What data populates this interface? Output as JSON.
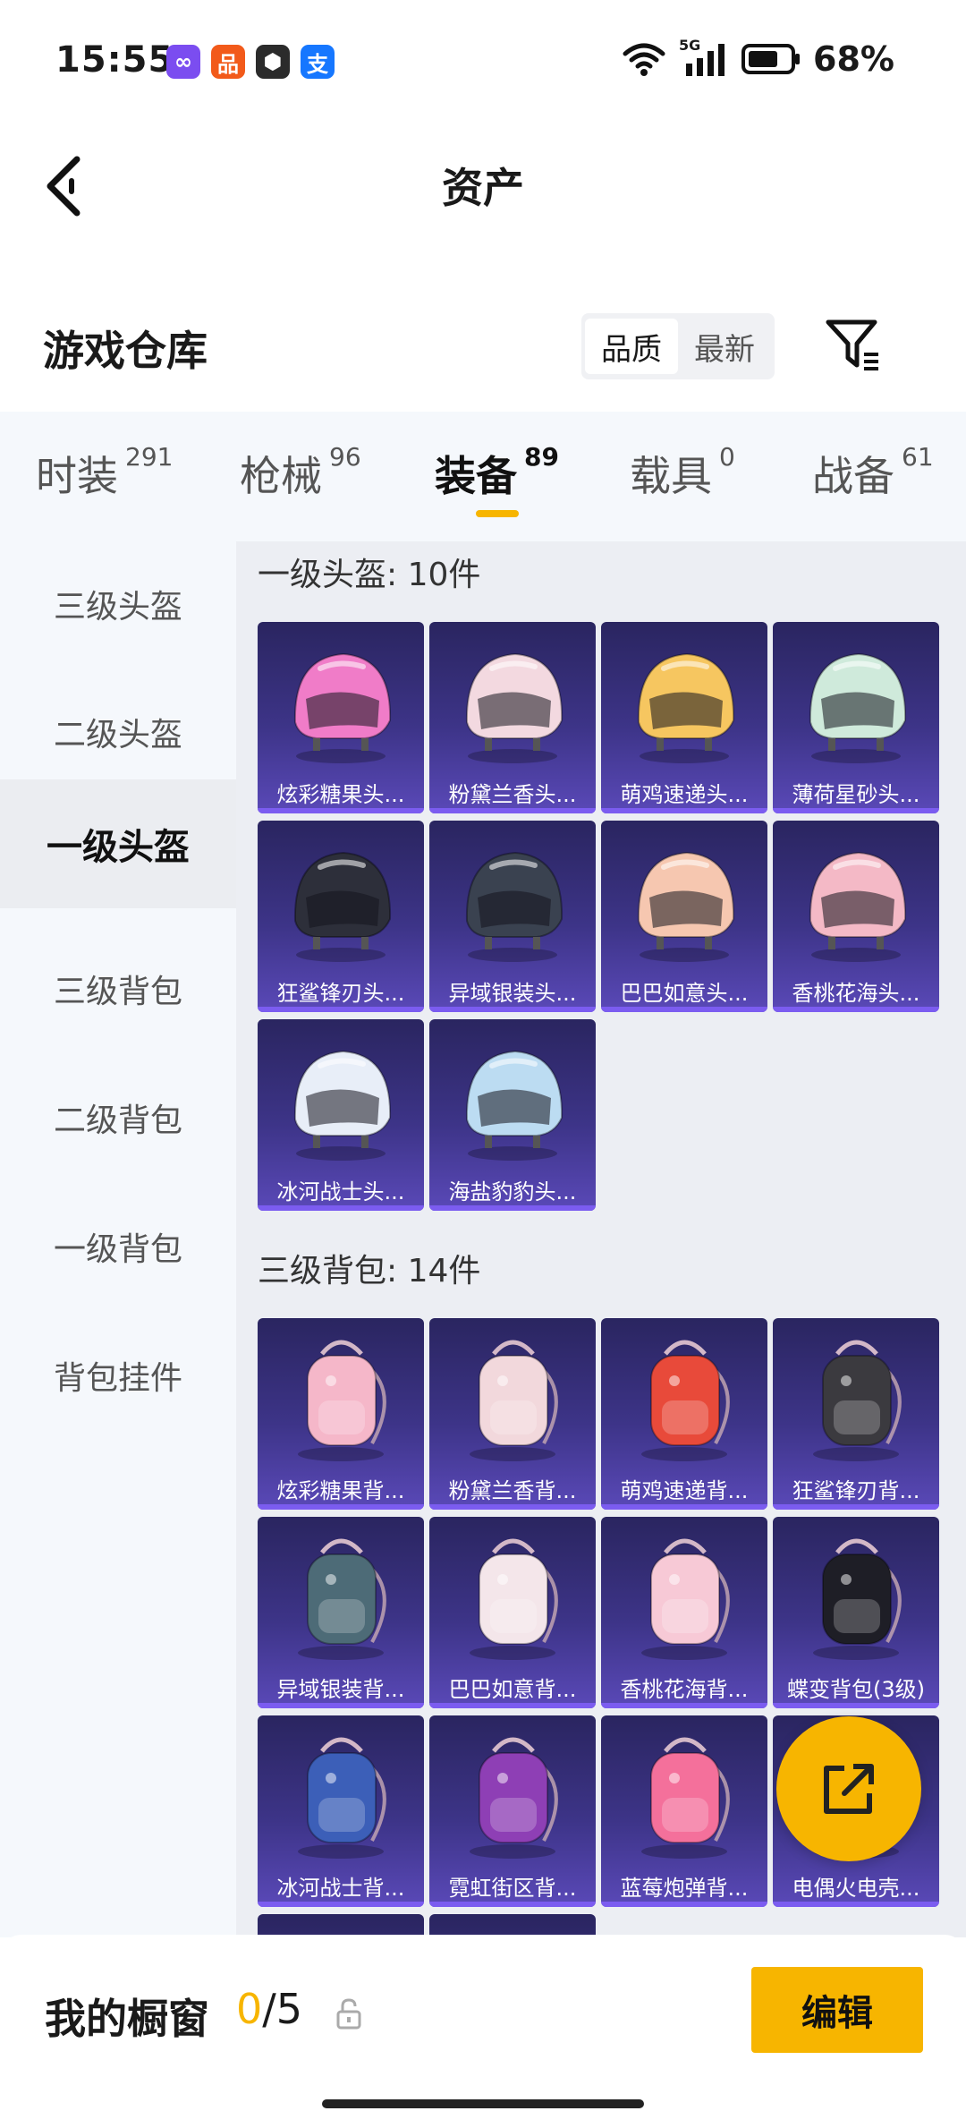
{
  "status_bar": {
    "time": "15:55",
    "network": "5G",
    "battery": "68%",
    "app_icons": [
      {
        "name": "infinity-app-icon",
        "glyph": "∞",
        "color": "#7b4df0"
      },
      {
        "name": "xiaohongshu-app-icon",
        "glyph": "品",
        "color": "#f25a1a"
      },
      {
        "name": "game-app-icon",
        "glyph": "⬢",
        "color": "#2b2b2b"
      },
      {
        "name": "alipay-app-icon",
        "glyph": "支",
        "color": "#1677ff"
      }
    ]
  },
  "header": {
    "title": "资产"
  },
  "section": {
    "title": "游戏仓库",
    "sort_options": [
      "品质",
      "最新"
    ],
    "active_sort": 0
  },
  "tabs": [
    {
      "label": "时装",
      "count": "291"
    },
    {
      "label": "枪械",
      "count": "96"
    },
    {
      "label": "装备",
      "count": "89"
    },
    {
      "label": "载具",
      "count": "0"
    },
    {
      "label": "战备",
      "count": "61"
    }
  ],
  "active_tab": 2,
  "side_nav": [
    "三级头盔",
    "二级头盔",
    "一级头盔",
    "三级背包",
    "二级背包",
    "一级背包",
    "背包挂件"
  ],
  "active_side": 2,
  "groups": [
    {
      "title": "一级头盔: 10件",
      "items": [
        {
          "label": "炫彩糖果头...",
          "color": "#f07cc8",
          "kind": "helmet"
        },
        {
          "label": "粉黛兰香头...",
          "color": "#f3d9e0",
          "kind": "helmet"
        },
        {
          "label": "萌鸡速递头...",
          "color": "#f6c660",
          "kind": "helmet"
        },
        {
          "label": "薄荷星砂头...",
          "color": "#cfeadb",
          "kind": "helmet"
        },
        {
          "label": "狂鲨锋刃头...",
          "color": "#2d2f3a",
          "kind": "helmet"
        },
        {
          "label": "异域银装头...",
          "color": "#3a4250",
          "kind": "helmet"
        },
        {
          "label": "巴巴如意头...",
          "color": "#f6c7b0",
          "kind": "helmet"
        },
        {
          "label": "香桃花海头...",
          "color": "#f4b9c6",
          "kind": "helmet"
        },
        {
          "label": "冰河战士头...",
          "color": "#e8eef8",
          "kind": "helmet"
        },
        {
          "label": "海盐豹豹头...",
          "color": "#bcdcf2",
          "kind": "helmet"
        }
      ]
    },
    {
      "title": "三级背包: 14件",
      "items": [
        {
          "label": "炫彩糖果背...",
          "color": "#f5b7c9",
          "kind": "backpack"
        },
        {
          "label": "粉黛兰香背...",
          "color": "#f2d8dc",
          "kind": "backpack"
        },
        {
          "label": "萌鸡速递背...",
          "color": "#e84a3a",
          "kind": "backpack"
        },
        {
          "label": "狂鲨锋刃背...",
          "color": "#3b3a3f",
          "kind": "backpack"
        },
        {
          "label": "异域银装背...",
          "color": "#4d6b77",
          "kind": "backpack"
        },
        {
          "label": "巴巴如意背...",
          "color": "#f4e6ea",
          "kind": "backpack"
        },
        {
          "label": "香桃花海背...",
          "color": "#f7c9d6",
          "kind": "backpack"
        },
        {
          "label": "蝶变背包(3级)",
          "color": "#1e1e26",
          "kind": "backpack"
        },
        {
          "label": "冰河战士背...",
          "color": "#3c5fb8",
          "kind": "backpack"
        },
        {
          "label": "霓虹街区背...",
          "color": "#8e3fb5",
          "kind": "backpack"
        },
        {
          "label": "蓝莓炮弹背...",
          "color": "#f4709b",
          "kind": "backpack"
        },
        {
          "label": "电偶火电壳...",
          "color": "#2b2b40",
          "kind": "backpack"
        },
        {
          "label": "",
          "color": "#d83a4a",
          "kind": "backpack"
        },
        {
          "label": "",
          "color": "#f2d3de",
          "kind": "backpack"
        }
      ]
    }
  ],
  "showcase": {
    "label": "我的橱窗",
    "current": "0",
    "separator": "/",
    "total": "5",
    "edit_label": "编辑"
  },
  "colors": {
    "accent": "#f7b500",
    "card_top": "#2a2560",
    "card_bottom": "#5a49b8"
  }
}
